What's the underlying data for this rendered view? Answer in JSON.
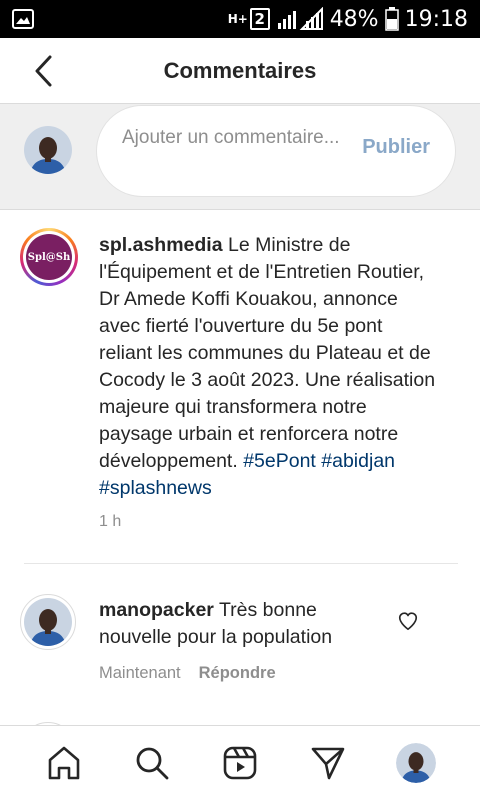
{
  "status_bar": {
    "network_type": "H+",
    "sim_slot": "2",
    "battery_percent": "48%",
    "time": "19:18",
    "icons": [
      "gallery-icon",
      "signal-icon",
      "battery-icon"
    ]
  },
  "header": {
    "title": "Commentaires",
    "back_icon": "arrow-left-icon"
  },
  "composer": {
    "placeholder": "Ajouter un commentaire...",
    "publish_label": "Publier"
  },
  "post": {
    "username": "spl.ashmedia",
    "avatar_text": "Spl@Sh",
    "caption": "Le Ministre de l'Équipement et de l'Entretien Routier, Dr Amede Koffi Kouakou, annonce avec fierté l'ouverture du 5e pont reliant les communes du Plateau et de Cocody le 3 août 2023. Une réalisation majeure qui transformera notre paysage urbain et renforcera notre développement.",
    "hashtags": "#5ePont #abidjan #splashnews",
    "time": "1 h"
  },
  "comments": [
    {
      "username": "manopacker",
      "text": "Très bonne nouvelle pour la population",
      "time": "Maintenant",
      "reply_label": "Répondre"
    }
  ],
  "colors": {
    "publish": "#8aa8c8",
    "hashtag": "#00376b",
    "muted": "#8e8e8e",
    "brand_avatar": "#7a1f62"
  },
  "bottom_nav": {
    "items": [
      "home-icon",
      "search-icon",
      "reels-icon",
      "direct-icon",
      "profile-avatar"
    ]
  }
}
